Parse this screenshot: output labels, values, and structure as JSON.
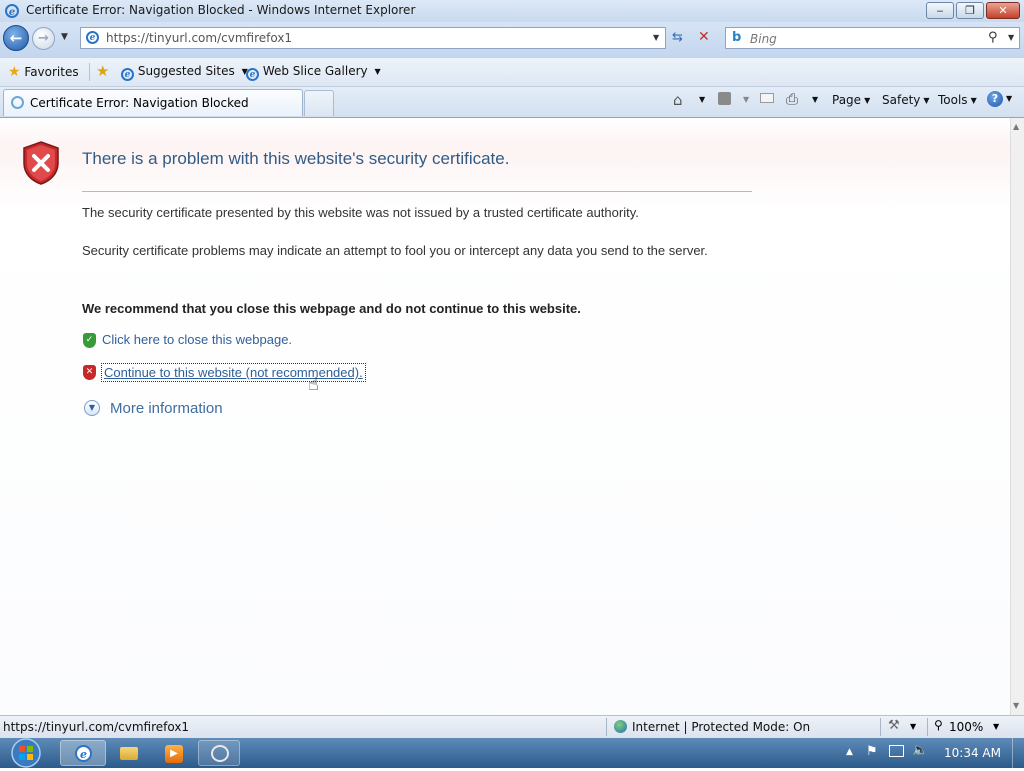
{
  "window": {
    "title": "Certificate Error: Navigation Blocked - Windows Internet Explorer",
    "minimize": "‒",
    "maximize": "❐",
    "close": "✕"
  },
  "address_bar": {
    "url": "https://tinyurl.com/cvmfirefox1",
    "search_placeholder": "Bing"
  },
  "favorites_bar": {
    "favorites": "Favorites",
    "suggested_sites": "Suggested Sites",
    "web_slice_gallery": "Web Slice Gallery"
  },
  "tab": {
    "active_label": "Certificate Error: Navigation Blocked"
  },
  "command_bar": {
    "page": "Page",
    "safety": "Safety",
    "tools": "Tools",
    "help": "?"
  },
  "page": {
    "heading": "There is a problem with this website's security certificate.",
    "para1": "The security certificate presented by this website was not issued by a trusted certificate authority.",
    "para2": "Security certificate problems may indicate an attempt to fool you or intercept any data you send to the server.",
    "recommendation": "We recommend that you close this webpage and do not continue to this website.",
    "close_link": "Click here to close this webpage.",
    "continue_link": "Continue to this website (not recommended).",
    "more_info": "More information"
  },
  "status_bar": {
    "url": "https://tinyurl.com/cvmfirefox1",
    "zone": "Internet | Protected Mode: On",
    "zoom": "100%"
  },
  "taskbar": {
    "clock": "10:34 AM"
  },
  "colors": {
    "heading": "#325b84",
    "link": "#2f5f9a",
    "error_red": "#c52a2a",
    "ok_green": "#3a9a3a"
  }
}
